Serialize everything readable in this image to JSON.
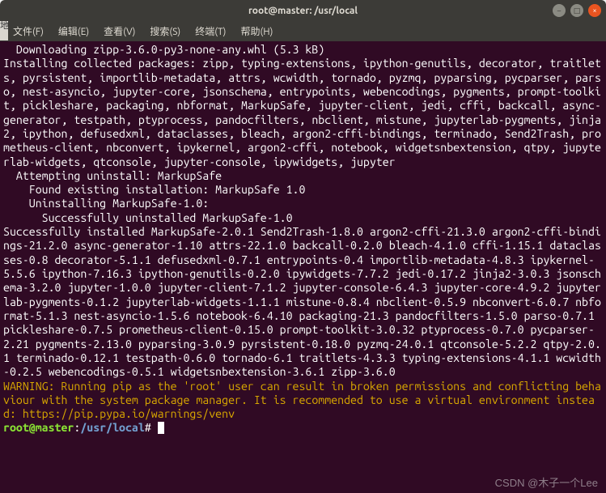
{
  "titlebar": {
    "title": "root@master: /usr/local"
  },
  "window_controls": {
    "minimize": "–",
    "maximize": "□",
    "close": "×"
  },
  "menubar": {
    "items": [
      "文件(F)",
      "编辑(E)",
      "查看(V)",
      "搜索(S)",
      "终端(T)",
      "帮助(H)"
    ]
  },
  "left_tab": "地",
  "terminal": {
    "lines": {
      "l0": "  Downloading zipp-3.6.0-py3-none-any.whl (5.3 kB)",
      "l1": "Installing collected packages: zipp, typing-extensions, ipython-genutils, decorator, traitlets, pyrsistent, importlib-metadata, attrs, wcwidth, tornado, pyzmq, pyparsing, pycparser, parso, nest-asyncio, jupyter-core, jsonschema, entrypoints, webencodings, pygments, prompt-toolkit, pickleshare, packaging, nbformat, MarkupSafe, jupyter-client, jedi, cffi, backcall, async-generator, testpath, ptyprocess, pandocfilters, nbclient, mistune, jupyterlab-pygments, jinja2, ipython, defusedxml, dataclasses, bleach, argon2-cffi-bindings, terminado, Send2Trash, prometheus-client, nbconvert, ipykernel, argon2-cffi, notebook, widgetsnbextension, qtpy, jupyterlab-widgets, qtconsole, jupyter-console, ipywidgets, jupyter",
      "l2": "  Attempting uninstall: MarkupSafe",
      "l3": "    Found existing installation: MarkupSafe 1.0",
      "l4": "    Uninstalling MarkupSafe-1.0:",
      "l5": "      Successfully uninstalled MarkupSafe-1.0",
      "l6": "Successfully installed MarkupSafe-2.0.1 Send2Trash-1.8.0 argon2-cffi-21.3.0 argon2-cffi-bindings-21.2.0 async-generator-1.10 attrs-22.1.0 backcall-0.2.0 bleach-4.1.0 cffi-1.15.1 dataclasses-0.8 decorator-5.1.1 defusedxml-0.7.1 entrypoints-0.4 importlib-metadata-4.8.3 ipykernel-5.5.6 ipython-7.16.3 ipython-genutils-0.2.0 ipywidgets-7.7.2 jedi-0.17.2 jinja2-3.0.3 jsonschema-3.2.0 jupyter-1.0.0 jupyter-client-7.1.2 jupyter-console-6.4.3 jupyter-core-4.9.2 jupyterlab-pygments-0.1.2 jupyterlab-widgets-1.1.1 mistune-0.8.4 nbclient-0.5.9 nbconvert-6.0.7 nbformat-5.1.3 nest-asyncio-1.5.6 notebook-6.4.10 packaging-21.3 pandocfilters-1.5.0 parso-0.7.1 pickleshare-0.7.5 prometheus-client-0.15.0 prompt-toolkit-3.0.32 ptyprocess-0.7.0 pycparser-2.21 pygments-2.13.0 pyparsing-3.0.9 pyrsistent-0.18.0 pyzmq-24.0.1 qtconsole-5.2.2 qtpy-2.0.1 terminado-0.12.1 testpath-0.6.0 tornado-6.1 traitlets-4.3.3 typing-extensions-4.1.1 wcwidth-0.2.5 webencodings-0.5.1 widgetsnbextension-3.6.1 zipp-3.6.0",
      "warning": "WARNING: Running pip as the 'root' user can result in broken permissions and conflicting behaviour with the system package manager. It is recommended to use a virtual environment instead: https://pip.pypa.io/warnings/venv"
    },
    "prompt": {
      "user_host": "root@master",
      "colon": ":",
      "path": "/usr/local",
      "char": "#"
    }
  },
  "watermark": "CSDN @木子一个Lee"
}
